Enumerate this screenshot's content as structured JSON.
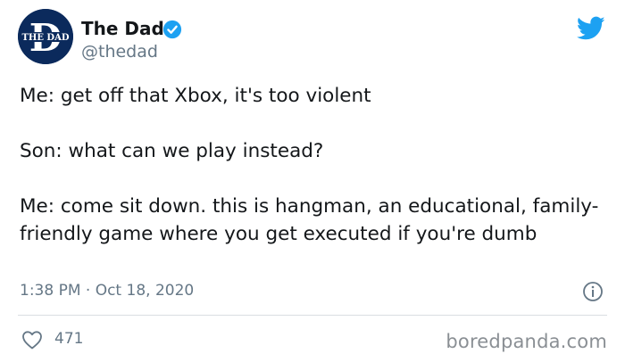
{
  "author": {
    "display_name": "The Dad",
    "handle": "@thedad",
    "avatar_label": "THE DAD",
    "verified": true,
    "avatar_icon": "the-dad-logo",
    "verified_icon": "verified-badge-icon"
  },
  "platform_icon": "twitter-bird-icon",
  "tweet": {
    "paragraphs": [
      "Me: get off that Xbox, it's too violent",
      "Son: what can we play instead?",
      "Me: come sit down. this is hangman, an educational, family-friendly game where you get executed if you're dumb"
    ],
    "timestamp": "1:38 PM · Oct 18, 2020"
  },
  "actions": {
    "like_icon": "heart-icon",
    "like_count": "471",
    "info_icon": "info-icon"
  },
  "watermark": "boredpanda.com",
  "colors": {
    "twitter_blue": "#1da1f2",
    "avatar_navy": "#0b2a5c",
    "secondary_text": "#657786"
  }
}
